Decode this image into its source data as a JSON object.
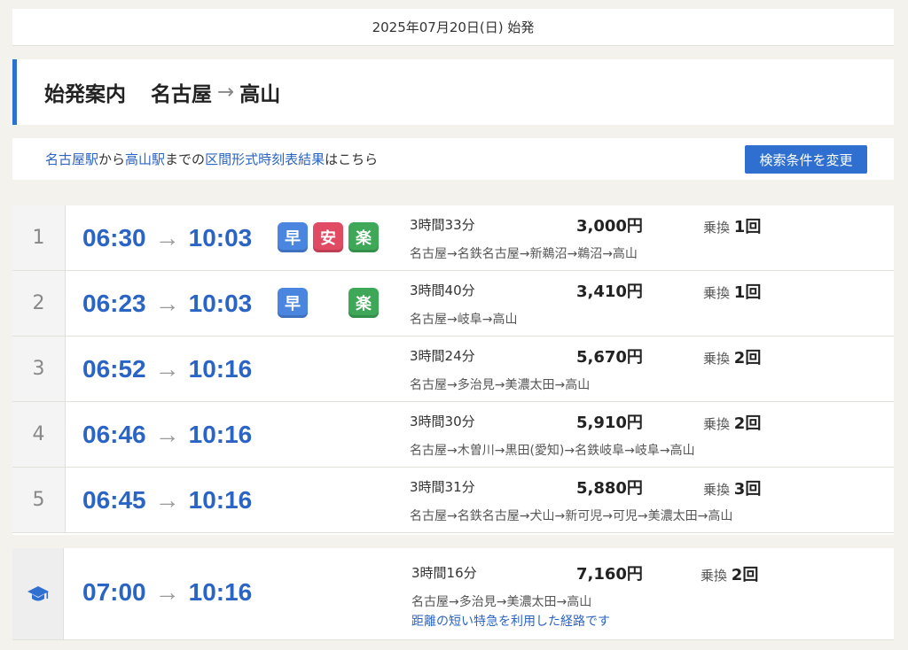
{
  "date_bar": "2025年07月20日(日) 始発",
  "title": {
    "label": "始発案内",
    "from": "名古屋",
    "arrow": "→",
    "to": "高山"
  },
  "link_bar": {
    "from_station": "名古屋駅",
    "text1": "から",
    "to_station": "高山駅",
    "text2": "までの",
    "timetable_link": "区間形式時刻表結果",
    "text3": "はこちら",
    "change_button": "検索条件を変更"
  },
  "colors": {
    "accent": "#2f6fd0",
    "link": "#2a64c4",
    "badge_early": "#4a86e0",
    "badge_cheap": "#e04a63",
    "badge_easy": "#3ea858"
  },
  "routes": [
    {
      "index": "1",
      "depart": "06:30",
      "arrow": "→",
      "arrive": "10:03",
      "badges": [
        "早",
        "安",
        "楽"
      ],
      "duration": "3時間33分",
      "fare": "3,000円",
      "transfer_label": "乗換",
      "transfer_count": "1回",
      "via": "名古屋→名鉄名古屋→新鵜沼→鵜沼→高山"
    },
    {
      "index": "2",
      "depart": "06:23",
      "arrow": "→",
      "arrive": "10:03",
      "badges": [
        "早",
        "",
        "楽"
      ],
      "duration": "3時間40分",
      "fare": "3,410円",
      "transfer_label": "乗換",
      "transfer_count": "1回",
      "via": "名古屋→岐阜→高山"
    },
    {
      "index": "3",
      "depart": "06:52",
      "arrow": "→",
      "arrive": "10:16",
      "badges": [],
      "duration": "3時間24分",
      "fare": "5,670円",
      "transfer_label": "乗換",
      "transfer_count": "2回",
      "via": "名古屋→多治見→美濃太田→高山"
    },
    {
      "index": "4",
      "depart": "06:46",
      "arrow": "→",
      "arrive": "10:16",
      "badges": [],
      "duration": "3時間30分",
      "fare": "5,910円",
      "transfer_label": "乗換",
      "transfer_count": "2回",
      "via": "名古屋→木曽川→黒田(愛知)→名鉄岐阜→岐阜→高山"
    },
    {
      "index": "5",
      "depart": "06:45",
      "arrow": "→",
      "arrive": "10:16",
      "badges": [],
      "duration": "3時間31分",
      "fare": "5,880円",
      "transfer_label": "乗換",
      "transfer_count": "3回",
      "via": "名古屋→名鉄名古屋→犬山→新可児→可児→美濃太田→高山"
    }
  ],
  "special_route": {
    "icon": "graduation-cap-icon",
    "depart": "07:00",
    "arrow": "→",
    "arrive": "10:16",
    "duration": "3時間16分",
    "fare": "7,160円",
    "transfer_label": "乗換",
    "transfer_count": "2回",
    "via": "名古屋→多治見→美濃太田→高山",
    "note": "距離の短い特急を利用した経路です"
  }
}
